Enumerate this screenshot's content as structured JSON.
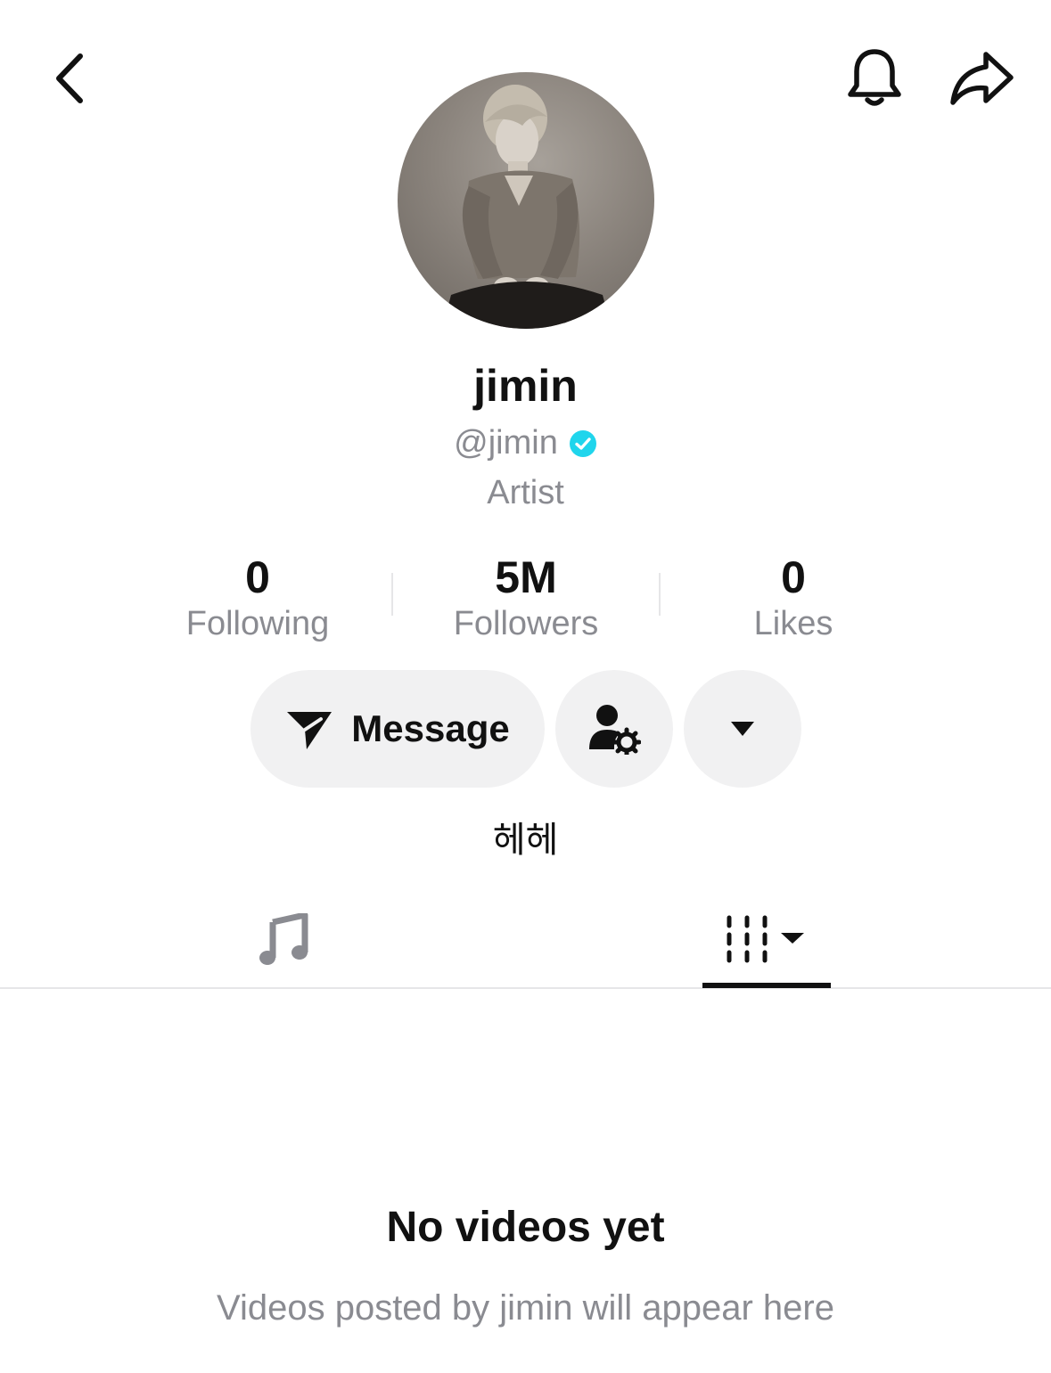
{
  "profile": {
    "display_name": "jimin",
    "handle": "@jimin",
    "category": "Artist",
    "bio": "헤헤",
    "verified_color": "#20d5ec"
  },
  "stats": {
    "following": {
      "value": "0",
      "label": "Following"
    },
    "followers": {
      "value": "5M",
      "label": "Followers"
    },
    "likes": {
      "value": "0",
      "label": "Likes"
    }
  },
  "actions": {
    "message_label": "Message"
  },
  "tabs": [
    {
      "icon": "music-note-icon",
      "selected": false
    },
    {
      "icon": "video-grid-icon",
      "selected": true
    }
  ],
  "empty_state": {
    "title": "No videos yet",
    "subtitle": "Videos posted by jimin will appear here"
  },
  "icons": {
    "back": "chevron-left-icon",
    "notifications": "bell-icon",
    "share": "share-arrow-icon",
    "message": "paper-plane-icon",
    "manage": "user-gear-icon",
    "more": "caret-down-icon"
  }
}
